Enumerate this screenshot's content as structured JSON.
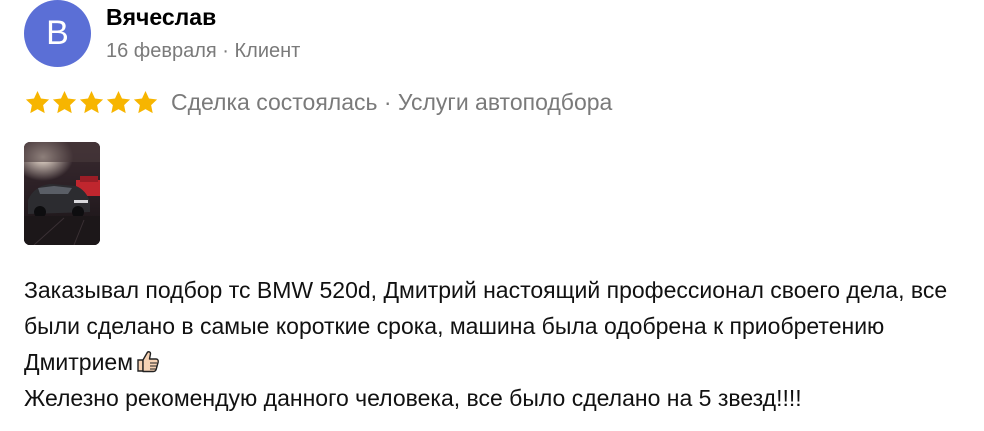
{
  "author": {
    "avatar_letter": "B",
    "name": "Вячеслав",
    "meta": "16 февраля · Клиент"
  },
  "rating": {
    "stars": 5,
    "max_stars": 5,
    "star_color": "#f7b500",
    "deal_info": "Сделка состоялась · Услуги автоподбора"
  },
  "photo": {
    "icon": "car-photo"
  },
  "review": {
    "line1": "Заказывал подбор тс BMW 520d, Дмитрий настоящий профессионал своего дела, все были сделано в самые короткие срока, машина была одобрена к приобретению Дмитрием",
    "emoji": "thumbs-up-icon",
    "line2": "Железно рекомендую данного человека, все было сделано на 5 звезд!!!!"
  },
  "colors": {
    "avatar_bg": "#5b6fd6",
    "meta_text": "#7a7a7a"
  }
}
